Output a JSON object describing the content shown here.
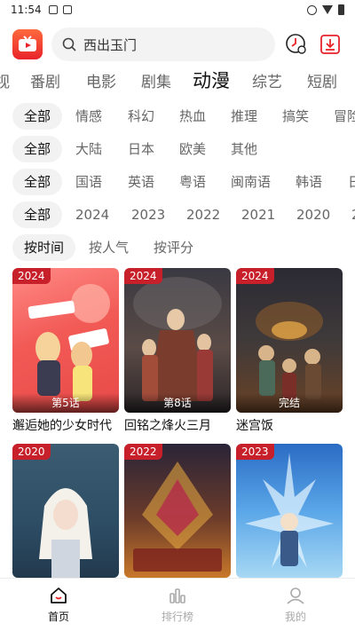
{
  "status": {
    "time": "11:54"
  },
  "search": {
    "placeholder": "西出玉门"
  },
  "colors": {
    "accent": "#e8232a",
    "year_badge": "#c8202a"
  },
  "category_tabs": [
    "视",
    "番剧",
    "电影",
    "剧集",
    "动漫",
    "综艺",
    "短剧"
  ],
  "active_category": "动漫",
  "filters": {
    "genre": [
      "全部",
      "情感",
      "科幻",
      "热血",
      "推理",
      "搞笑",
      "冒险"
    ],
    "region": [
      "全部",
      "大陆",
      "日本",
      "欧美",
      "其他"
    ],
    "language": [
      "全部",
      "国语",
      "英语",
      "粤语",
      "闽南语",
      "韩语",
      "日"
    ],
    "year": [
      "全部",
      "2024",
      "2023",
      "2022",
      "2021",
      "2020",
      "2"
    ],
    "sort": [
      "按时间",
      "按人气",
      "按评分"
    ]
  },
  "cards": [
    {
      "year": "2024",
      "episode": "第5话",
      "title": "邂逅她的少女时代"
    },
    {
      "year": "2024",
      "episode": "第8话",
      "title": "回铭之烽火三月"
    },
    {
      "year": "2024",
      "episode": "完结",
      "title": "迷宫饭"
    },
    {
      "year": "2020",
      "episode": "",
      "title": ""
    },
    {
      "year": "2022",
      "episode": "",
      "title": ""
    },
    {
      "year": "2023",
      "episode": "",
      "title": ""
    }
  ],
  "bottom_nav": [
    {
      "label": "首页",
      "icon": "home-icon"
    },
    {
      "label": "排行榜",
      "icon": "ranking-icon"
    },
    {
      "label": "我的",
      "icon": "profile-icon"
    }
  ]
}
